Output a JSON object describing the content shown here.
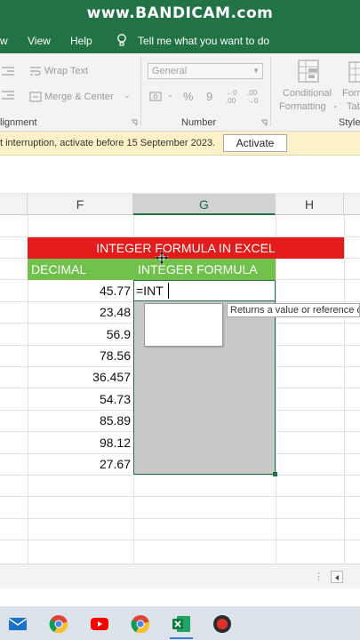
{
  "watermark": "www.BANDICAM.com",
  "ribbon_tabs": {
    "view": "View",
    "help": "Help",
    "tell_me": "Tell me what you want to do"
  },
  "ribbon": {
    "wrap_text": "Wrap Text",
    "merge_center": "Merge & Center",
    "alignment_group": "Alignment",
    "number_format": "General",
    "number_group": "Number",
    "conditional_line1": "Conditional",
    "conditional_line2": "Formatting",
    "format_table_line1": "Form",
    "format_table_line2": "Tab",
    "styles_group": "Style"
  },
  "license_bar": {
    "message": "t interruption, activate before 15 September 2023.",
    "activate_label": "Activate"
  },
  "columns": {
    "f": "F",
    "g": "G",
    "h": "H"
  },
  "sheet": {
    "title": "INTEGER FORMULA IN EXCEL",
    "header_decimal": "DECIMAL",
    "header_integer": "INTEGER FORMULA",
    "active_cell_text": "=INT",
    "decimals": [
      "45.77",
      "23.48",
      "56.9",
      "78.56",
      "36.457",
      "54.73",
      "85.89",
      "98.12",
      "27.67"
    ]
  },
  "tooltip": "Returns a value or reference o",
  "colors": {
    "excel_green": "#217346",
    "title_red": "#e31b1b",
    "header_green": "#70c14b",
    "license_yellow": "#fdf2c7"
  },
  "taskbar_icons": [
    "mail-icon",
    "chrome-icon",
    "youtube-icon",
    "chrome-icon",
    "excel-icon",
    "bandicam-record-icon"
  ]
}
